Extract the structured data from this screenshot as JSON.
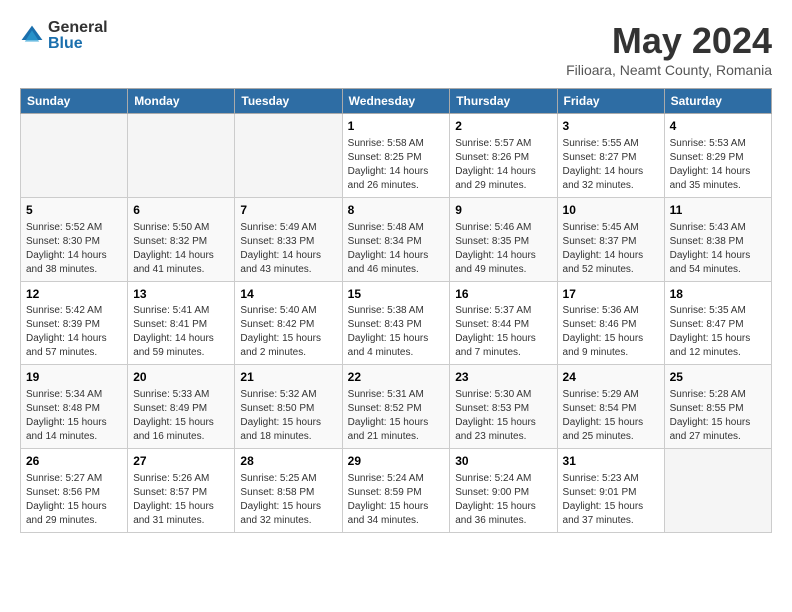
{
  "logo": {
    "general": "General",
    "blue": "Blue"
  },
  "header": {
    "month": "May 2024",
    "location": "Filioara, Neamt County, Romania"
  },
  "weekdays": [
    "Sunday",
    "Monday",
    "Tuesday",
    "Wednesday",
    "Thursday",
    "Friday",
    "Saturday"
  ],
  "weeks": [
    [
      {
        "day": "",
        "info": ""
      },
      {
        "day": "",
        "info": ""
      },
      {
        "day": "",
        "info": ""
      },
      {
        "day": "1",
        "info": "Sunrise: 5:58 AM\nSunset: 8:25 PM\nDaylight: 14 hours and 26 minutes."
      },
      {
        "day": "2",
        "info": "Sunrise: 5:57 AM\nSunset: 8:26 PM\nDaylight: 14 hours and 29 minutes."
      },
      {
        "day": "3",
        "info": "Sunrise: 5:55 AM\nSunset: 8:27 PM\nDaylight: 14 hours and 32 minutes."
      },
      {
        "day": "4",
        "info": "Sunrise: 5:53 AM\nSunset: 8:29 PM\nDaylight: 14 hours and 35 minutes."
      }
    ],
    [
      {
        "day": "5",
        "info": "Sunrise: 5:52 AM\nSunset: 8:30 PM\nDaylight: 14 hours and 38 minutes."
      },
      {
        "day": "6",
        "info": "Sunrise: 5:50 AM\nSunset: 8:32 PM\nDaylight: 14 hours and 41 minutes."
      },
      {
        "day": "7",
        "info": "Sunrise: 5:49 AM\nSunset: 8:33 PM\nDaylight: 14 hours and 43 minutes."
      },
      {
        "day": "8",
        "info": "Sunrise: 5:48 AM\nSunset: 8:34 PM\nDaylight: 14 hours and 46 minutes."
      },
      {
        "day": "9",
        "info": "Sunrise: 5:46 AM\nSunset: 8:35 PM\nDaylight: 14 hours and 49 minutes."
      },
      {
        "day": "10",
        "info": "Sunrise: 5:45 AM\nSunset: 8:37 PM\nDaylight: 14 hours and 52 minutes."
      },
      {
        "day": "11",
        "info": "Sunrise: 5:43 AM\nSunset: 8:38 PM\nDaylight: 14 hours and 54 minutes."
      }
    ],
    [
      {
        "day": "12",
        "info": "Sunrise: 5:42 AM\nSunset: 8:39 PM\nDaylight: 14 hours and 57 minutes."
      },
      {
        "day": "13",
        "info": "Sunrise: 5:41 AM\nSunset: 8:41 PM\nDaylight: 14 hours and 59 minutes."
      },
      {
        "day": "14",
        "info": "Sunrise: 5:40 AM\nSunset: 8:42 PM\nDaylight: 15 hours and 2 minutes."
      },
      {
        "day": "15",
        "info": "Sunrise: 5:38 AM\nSunset: 8:43 PM\nDaylight: 15 hours and 4 minutes."
      },
      {
        "day": "16",
        "info": "Sunrise: 5:37 AM\nSunset: 8:44 PM\nDaylight: 15 hours and 7 minutes."
      },
      {
        "day": "17",
        "info": "Sunrise: 5:36 AM\nSunset: 8:46 PM\nDaylight: 15 hours and 9 minutes."
      },
      {
        "day": "18",
        "info": "Sunrise: 5:35 AM\nSunset: 8:47 PM\nDaylight: 15 hours and 12 minutes."
      }
    ],
    [
      {
        "day": "19",
        "info": "Sunrise: 5:34 AM\nSunset: 8:48 PM\nDaylight: 15 hours and 14 minutes."
      },
      {
        "day": "20",
        "info": "Sunrise: 5:33 AM\nSunset: 8:49 PM\nDaylight: 15 hours and 16 minutes."
      },
      {
        "day": "21",
        "info": "Sunrise: 5:32 AM\nSunset: 8:50 PM\nDaylight: 15 hours and 18 minutes."
      },
      {
        "day": "22",
        "info": "Sunrise: 5:31 AM\nSunset: 8:52 PM\nDaylight: 15 hours and 21 minutes."
      },
      {
        "day": "23",
        "info": "Sunrise: 5:30 AM\nSunset: 8:53 PM\nDaylight: 15 hours and 23 minutes."
      },
      {
        "day": "24",
        "info": "Sunrise: 5:29 AM\nSunset: 8:54 PM\nDaylight: 15 hours and 25 minutes."
      },
      {
        "day": "25",
        "info": "Sunrise: 5:28 AM\nSunset: 8:55 PM\nDaylight: 15 hours and 27 minutes."
      }
    ],
    [
      {
        "day": "26",
        "info": "Sunrise: 5:27 AM\nSunset: 8:56 PM\nDaylight: 15 hours and 29 minutes."
      },
      {
        "day": "27",
        "info": "Sunrise: 5:26 AM\nSunset: 8:57 PM\nDaylight: 15 hours and 31 minutes."
      },
      {
        "day": "28",
        "info": "Sunrise: 5:25 AM\nSunset: 8:58 PM\nDaylight: 15 hours and 32 minutes."
      },
      {
        "day": "29",
        "info": "Sunrise: 5:24 AM\nSunset: 8:59 PM\nDaylight: 15 hours and 34 minutes."
      },
      {
        "day": "30",
        "info": "Sunrise: 5:24 AM\nSunset: 9:00 PM\nDaylight: 15 hours and 36 minutes."
      },
      {
        "day": "31",
        "info": "Sunrise: 5:23 AM\nSunset: 9:01 PM\nDaylight: 15 hours and 37 minutes."
      },
      {
        "day": "",
        "info": ""
      }
    ]
  ]
}
